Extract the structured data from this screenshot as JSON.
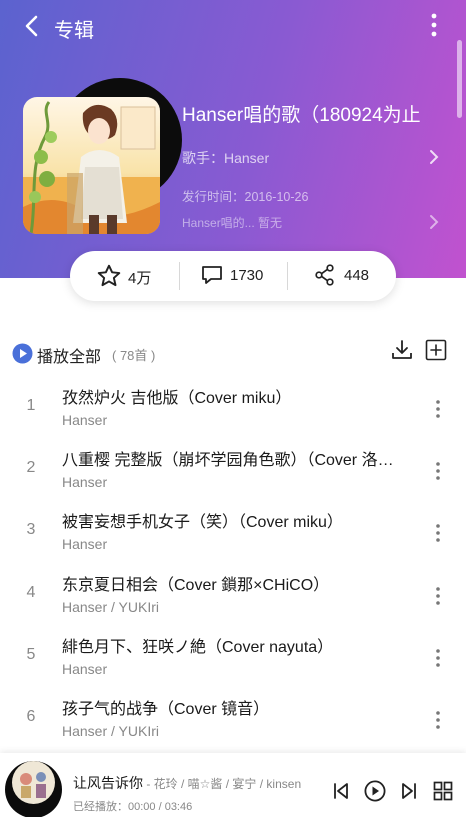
{
  "header": {
    "title": "专辑"
  },
  "album": {
    "name": "Hanser唱的歌（180924为止",
    "singer": "歌手：Hanser",
    "release": "发行时间：2016-10-26",
    "description": "Hanser唱的...  暂无"
  },
  "stats": {
    "favorites": "4万",
    "comments": "1730",
    "shares": "448"
  },
  "list_header": {
    "play_all": "播放全部",
    "count": "( 78首 )"
  },
  "songs": [
    {
      "index": "1",
      "title": "孜然炉火 吉他版（Cover miku）",
      "artist": "Hanser"
    },
    {
      "index": "2",
      "title": "八重樱 完整版（崩坏学园角色歌）（Cover 洛天依）",
      "artist": "Hanser"
    },
    {
      "index": "3",
      "title": "被害妄想手机女子（笑）（Cover miku）",
      "artist": "Hanser"
    },
    {
      "index": "4",
      "title": "东京夏日相会（Cover 鎖那×CHiCO）",
      "artist": "Hanser / YUKIri"
    },
    {
      "index": "5",
      "title": "緋色月下、狂咲ノ絶（Cover nayuta）",
      "artist": "Hanser"
    },
    {
      "index": "6",
      "title": "孩子气的战争（Cover 镜音）",
      "artist": "Hanser / YUKIri"
    }
  ],
  "player": {
    "title": "让风告诉你",
    "artists": " - 花玲 / 喵☆酱 / 宴宁 / kinsen",
    "time": "已经播放：00:00 / 03:46"
  },
  "colors": {
    "gradient_start": "#5b63cf",
    "gradient_end": "#c152cf",
    "accent": "#4a70d9"
  }
}
